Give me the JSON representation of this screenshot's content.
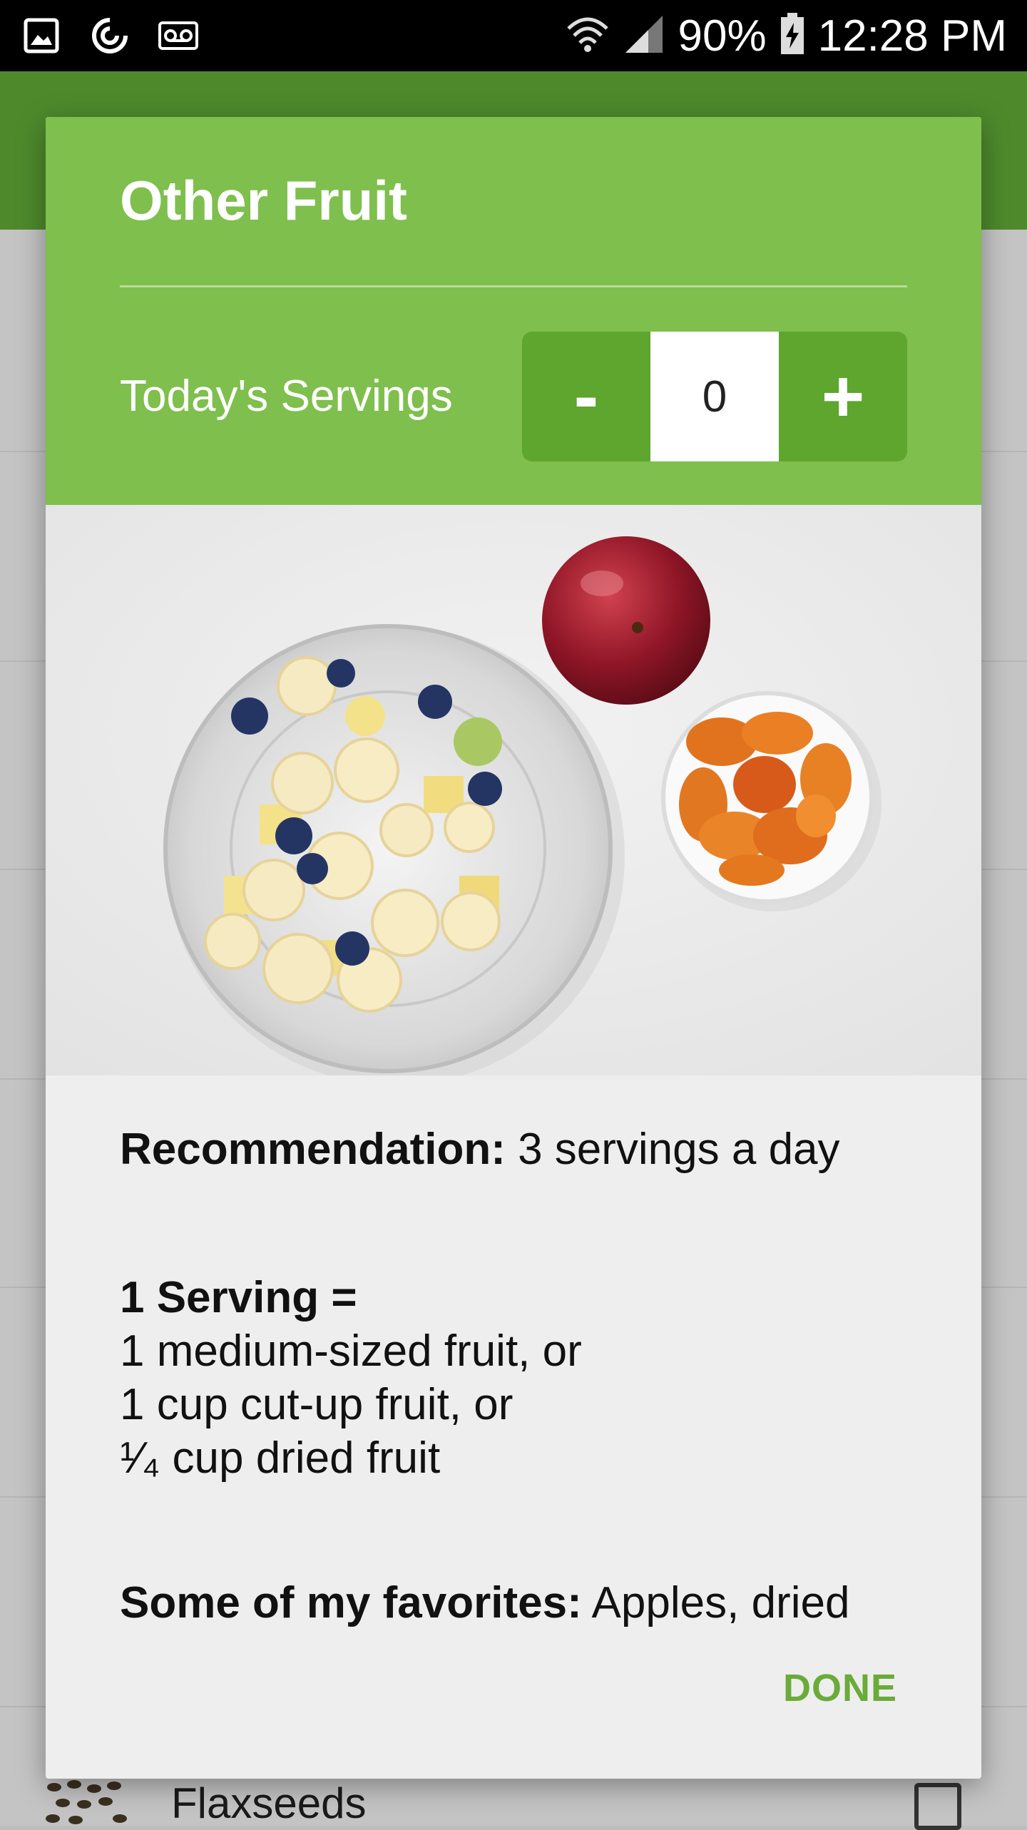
{
  "status_bar": {
    "icons": [
      "gallery-icon",
      "sync-icon",
      "voicemail-icon",
      "wifi-icon",
      "signal-icon",
      "battery-charging-icon"
    ],
    "battery": "90%",
    "time": "12:28 PM"
  },
  "background_list": {
    "partial_item_label": "Flaxseeds"
  },
  "dialog": {
    "title": "Other Fruit",
    "servings_label": "Today's Servings",
    "minus_label": "-",
    "servings_value": "0",
    "plus_label": "+",
    "recommendation_label": "Recommendation:",
    "recommendation_value": " 3 servings a day",
    "serving_heading": "1 Serving =",
    "serving_lines": [
      "1 medium-sized fruit, or",
      "1 cup cut-up fruit, or",
      "¹⁄₄ cup dried fruit"
    ],
    "favorites_label": "Some of my favorites:",
    "favorites_value": " Apples, dried",
    "done_label": "DONE"
  },
  "colors": {
    "header_green": "#7fbf4d",
    "stepper_green": "#5ea62d",
    "app_bar_green": "#4e8a2c",
    "done_green": "#6aab3a"
  }
}
